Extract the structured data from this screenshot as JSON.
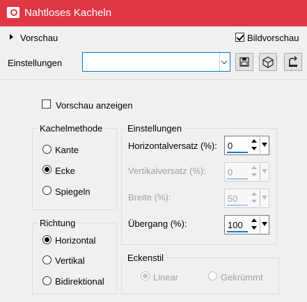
{
  "window": {
    "title": "Nahtloses Kacheln",
    "title_color": "#e03744"
  },
  "preview_toggle": {
    "label": "Vorschau"
  },
  "bild_preview": {
    "label": "Bildvorschau",
    "checked": true
  },
  "settings_bar": {
    "label": "Einstellungen",
    "combo_value": "",
    "buttons": [
      "save-icon",
      "cube-icon",
      "reset-icon"
    ]
  },
  "show_preview": {
    "label": "Vorschau anzeigen",
    "checked": false
  },
  "kachelmethode": {
    "title": "Kachelmethode",
    "options": [
      {
        "label": "Kante",
        "selected": false
      },
      {
        "label": "Ecke",
        "selected": true
      },
      {
        "label": "Spiegeln",
        "selected": false
      }
    ]
  },
  "einstellungen": {
    "title": "Einstellungen",
    "fields": [
      {
        "label": "Horizontalversatz (%):",
        "value": "0",
        "enabled": true
      },
      {
        "label": "Vertikalversatz (%):",
        "value": "0",
        "enabled": false
      },
      {
        "label": "Breite (%):",
        "value": "50",
        "enabled": false
      },
      {
        "label": "Übergang (%):",
        "value": "100",
        "enabled": true
      }
    ]
  },
  "richtung": {
    "title": "Richtung",
    "options": [
      {
        "label": "Horizontal",
        "selected": true
      },
      {
        "label": "Vertikal",
        "selected": false
      },
      {
        "label": "Bidirektional",
        "selected": false
      }
    ]
  },
  "eckenstil": {
    "title": "Eckenstil",
    "options": [
      {
        "label": "Linear",
        "selected": true,
        "enabled": false
      },
      {
        "label": "Gekrümmt",
        "selected": false,
        "enabled": false
      }
    ]
  }
}
